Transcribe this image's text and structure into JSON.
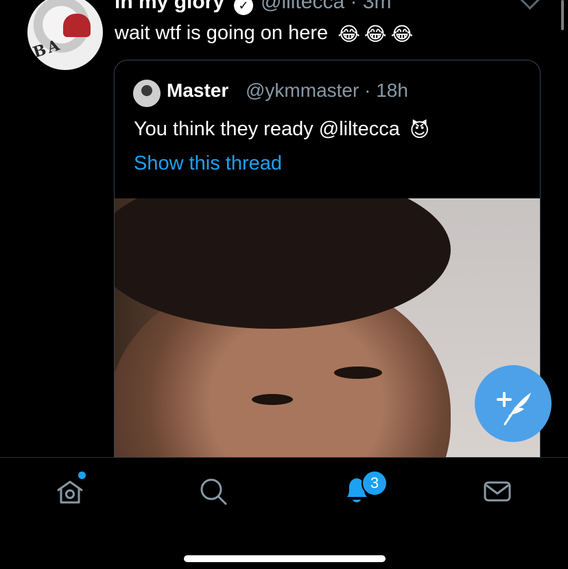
{
  "tweet": {
    "display_name": "in my glory",
    "handle": "@liltecca",
    "time": "3m",
    "text": "wait wtf is going on here",
    "emojis": [
      "😂",
      "😂",
      "😂"
    ]
  },
  "quoted_tweet": {
    "display_name": "Master",
    "handle": "@ykmmaster",
    "time": "18h",
    "text": "You think they ready @liltecca",
    "emoji": "😈",
    "link_text": "Show this thread"
  },
  "tab_bar": {
    "items": [
      "home-icon",
      "search-icon",
      "notifications-icon",
      "messages-icon"
    ],
    "notifications_badge": "3"
  },
  "colors": {
    "accent": "#1da1f2",
    "muted_text": "#8899a6",
    "background": "#000000",
    "fab": "#4da1e8"
  }
}
